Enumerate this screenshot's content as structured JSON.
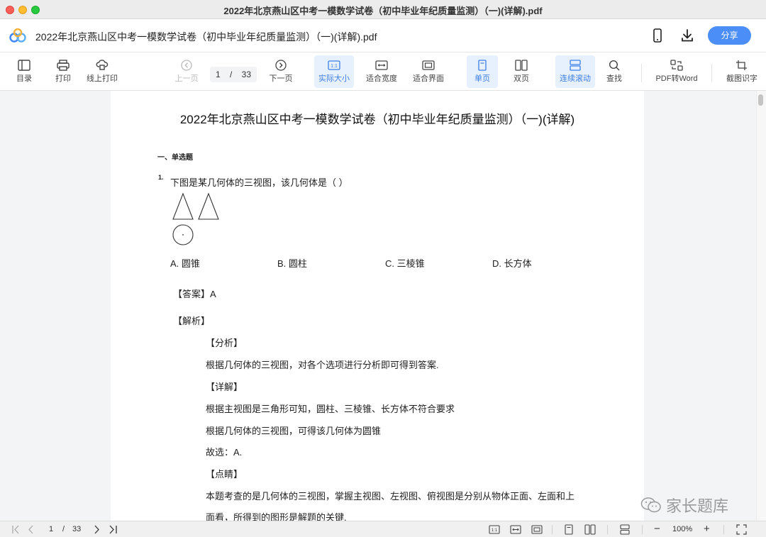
{
  "window": {
    "title": "2022年北京燕山区中考一模数学试卷（初中毕业年纪质量监测）（一)(详解).pdf"
  },
  "header": {
    "doc_title": "2022年北京燕山区中考一模数学试卷（初中毕业年纪质量监测）（一)(详解).pdf",
    "share_label": "分享"
  },
  "toolbar": {
    "toc": "目录",
    "print": "打印",
    "online_print": "线上打印",
    "prev": "上一页",
    "current_page": "1",
    "page_sep": "/",
    "total_pages": "33",
    "next": "下一页",
    "actual_size": "实际大小",
    "actual_size_icon": "1:1",
    "fit_width": "适合宽度",
    "fit_page": "适合界面",
    "single_page": "单页",
    "double_page": "双页",
    "continuous": "连续滚动",
    "find": "查找",
    "pdf_to_word": "PDF转Word",
    "ocr": "截图识字"
  },
  "document": {
    "title": "2022年北京燕山区中考一模数学试卷（初中毕业年纪质量监测）（一)(详解)",
    "section": "一、单选题",
    "question": {
      "number": "1.",
      "text": "下图是某几何体的三视图，该几何体是（        ）",
      "options": [
        "A. 圆锥",
        "B. 圆柱",
        "C. 三棱锥",
        "D. 长方体"
      ]
    },
    "answer": "【答案】A",
    "analysis_heading": "【解析】",
    "lines": [
      "【分析】",
      "根据几何体的三视图，对各个选项进行分析即可得到答案.",
      "【详解】",
      "根据主视图是三角形可知，圆柱、三棱锥、长方体不符合要求",
      "根据几何体的三视图，可得该几何体为圆锥",
      "故选：A.",
      "【点睛】",
      "本题考查的是几何体的三视图，掌握主视图、左视图、俯视图是分别从物体正面、左面和上",
      "面看，所得到的图形是解题的关键."
    ]
  },
  "watermark": {
    "text": "家长题库"
  },
  "statusbar": {
    "current_page": "1",
    "page_sep": "/",
    "total_pages": "33",
    "zoom": "100%",
    "actual_icon": "1:1",
    "zoom_out": "−",
    "zoom_in": "+"
  },
  "colors": {
    "accent": "#4c8ef7",
    "active_bg": "#e7f0fd",
    "active_text": "#3d7fe8"
  }
}
